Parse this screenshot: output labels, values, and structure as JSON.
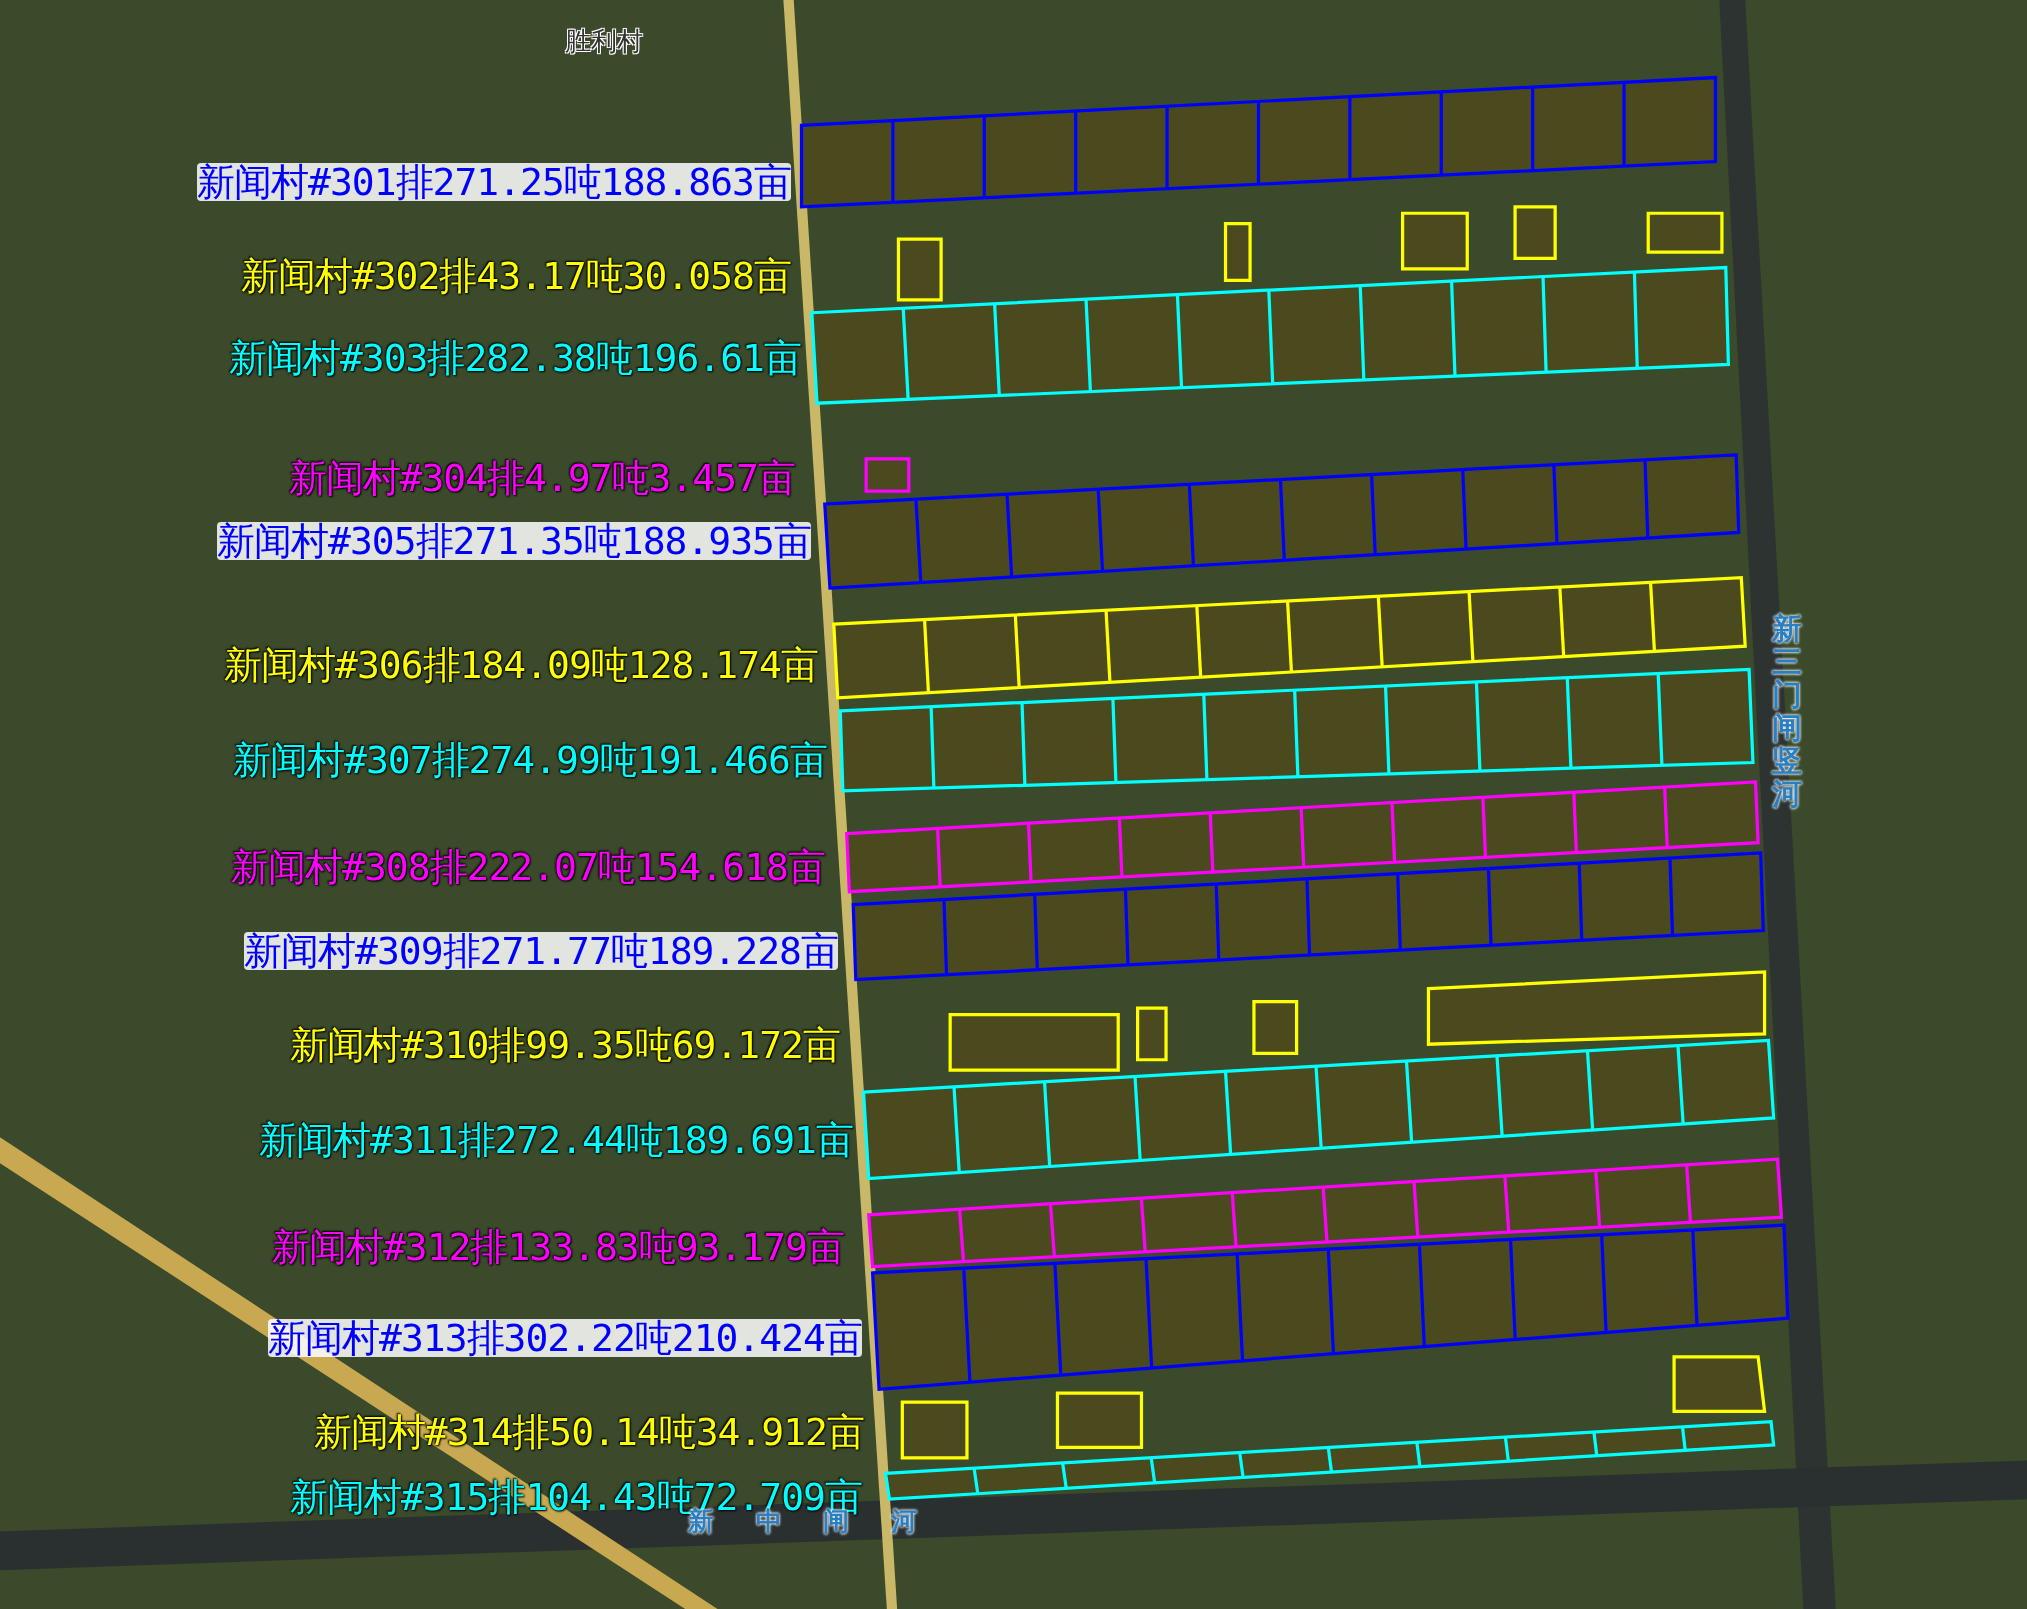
{
  "map": {
    "place_labels": [
      {
        "text": "胜利村",
        "kind": "village"
      },
      {
        "text": "新三门闸竖河",
        "kind": "river_vertical"
      },
      {
        "text": "新中闸河",
        "kind": "river"
      }
    ],
    "fields": [
      {
        "label": "新闻村#301排271.25吨188.863亩",
        "color": "#0000ff"
      },
      {
        "label": "新闻村#302排43.17吨30.058亩",
        "color": "#ffff00"
      },
      {
        "label": "新闻村#303排282.38吨196.61亩",
        "color": "#00ffff"
      },
      {
        "label": "新闻村#304排4.97吨3.457亩",
        "color": "#ff00ff"
      },
      {
        "label": "新闻村#305排271.35吨188.935亩",
        "color": "#0000ff"
      },
      {
        "label": "新闻村#306排184.09吨128.174亩",
        "color": "#ffff00"
      },
      {
        "label": "新闻村#307排274.99吨191.466亩",
        "color": "#00ffff"
      },
      {
        "label": "新闻村#308排222.07吨154.618亩",
        "color": "#ff00ff"
      },
      {
        "label": "新闻村#309排271.77吨189.228亩",
        "color": "#0000ff"
      },
      {
        "label": "新闻村#310排99.35吨69.172亩",
        "color": "#ffff00"
      },
      {
        "label": "新闻村#311排272.44吨189.691亩",
        "color": "#00ffff"
      },
      {
        "label": "新闻村#312排133.83吨93.179亩",
        "color": "#ff00ff"
      },
      {
        "label": "新闻村#313排302.22吨210.424亩",
        "color": "#0000ff"
      },
      {
        "label": "新闻村#314排50.14吨34.912亩",
        "color": "#ffff00"
      },
      {
        "label": "新闻村#315排104.43吨72.709亩",
        "color": "#00ffff"
      }
    ]
  }
}
